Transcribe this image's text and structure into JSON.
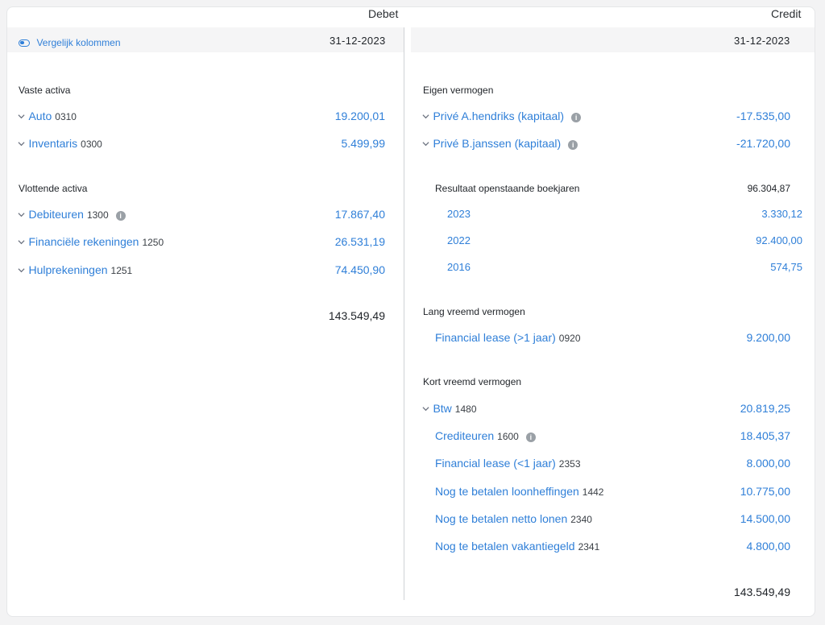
{
  "header": {
    "debit_label": "Debet",
    "credit_label": "Credit"
  },
  "debit_date": "31-12-2023",
  "credit_date": "31-12-2023",
  "compare_toggle": {
    "label": "Vergelijk kolommen"
  },
  "debit": {
    "vaste_activa": {
      "title": "Vaste activa",
      "items": [
        {
          "name": "Auto",
          "code": "0310",
          "amount": "19.200,01"
        },
        {
          "name": "Inventaris",
          "code": "0300",
          "amount": "5.499,99"
        }
      ]
    },
    "vlottende_activa": {
      "title": "Vlottende activa",
      "items": [
        {
          "name": "Debiteuren",
          "code": "1300",
          "amount": "17.867,40"
        },
        {
          "name": "Financiële rekeningen",
          "code": "1250",
          "amount": "26.531,19"
        },
        {
          "name": "Hulprekeningen",
          "code": "1251",
          "amount": "74.450,90"
        }
      ]
    },
    "total": "143.549,49"
  },
  "credit": {
    "eigen_vermogen": {
      "title": "Eigen vermogen",
      "items": [
        {
          "name": "Privé A.hendriks (kapitaal)",
          "amount": "-17.535,00"
        },
        {
          "name": "Privé B.janssen (kapitaal)",
          "amount": "-21.720,00"
        }
      ],
      "resultaat": {
        "label": "Resultaat openstaande boekjaren",
        "amount": "96.304,87",
        "years": [
          {
            "year": "2023",
            "amount": "3.330,12"
          },
          {
            "year": "2022",
            "amount": "92.400,00"
          },
          {
            "year": "2016",
            "amount": "574,75"
          }
        ]
      }
    },
    "lang_vreemd": {
      "title": "Lang vreemd vermogen",
      "items": [
        {
          "name": "Financial lease (>1 jaar)",
          "code": "0920",
          "amount": "9.200,00"
        }
      ]
    },
    "kort_vreemd": {
      "title": "Kort vreemd vermogen",
      "items": [
        {
          "name": "Btw",
          "code": "1480",
          "amount": "20.819,25"
        },
        {
          "name": "Crediteuren",
          "code": "1600",
          "amount": "18.405,37"
        },
        {
          "name": "Financial lease (<1 jaar)",
          "code": "2353",
          "amount": "8.000,00"
        },
        {
          "name": "Nog te betalen loonheffingen",
          "code": "1442",
          "amount": "10.775,00"
        },
        {
          "name": "Nog te betalen netto lonen",
          "code": "2340",
          "amount": "14.500,00"
        },
        {
          "name": "Nog te betalen vakantiegeld",
          "code": "2341",
          "amount": "4.800,00"
        }
      ]
    },
    "total": "143.549,49"
  }
}
